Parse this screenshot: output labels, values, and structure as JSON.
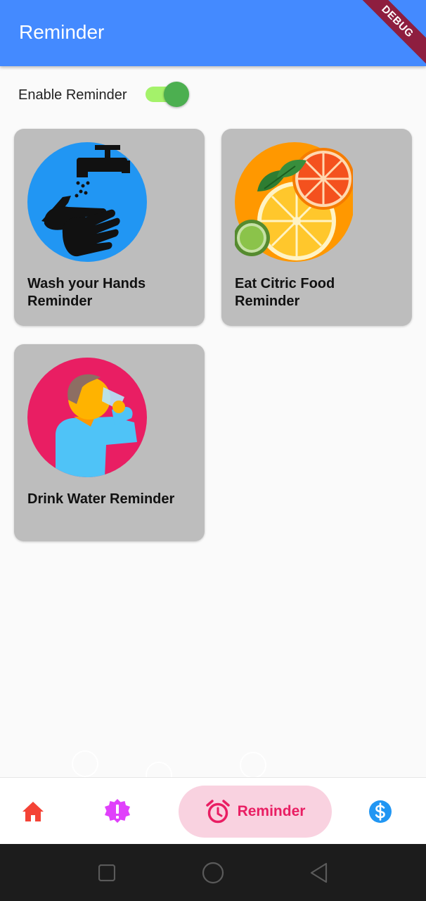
{
  "app_bar": {
    "title": "Reminder",
    "debug_banner": "DEBUG",
    "color": "#448aff"
  },
  "settings": {
    "enable_label": "Enable Reminder",
    "enabled": true
  },
  "reminders": [
    {
      "title": "Wash your Hands Reminder",
      "icon": "hand-wash-icon"
    },
    {
      "title": "Eat Citric Food Reminder",
      "icon": "citrus-fruit-icon"
    },
    {
      "title": "Drink Water Reminder",
      "icon": "drink-water-icon"
    }
  ],
  "bottom_nav": {
    "items": [
      {
        "icon": "home-icon",
        "color": "#f44336"
      },
      {
        "icon": "alert-badge-icon",
        "color": "#e040fb"
      },
      {
        "icon": "alarm-clock-icon",
        "label": "Reminder",
        "color": "#e91e63",
        "active": true
      },
      {
        "icon": "dollar-icon",
        "color": "#2196f3"
      }
    ]
  },
  "system_nav": {
    "buttons": [
      "recent-apps-icon",
      "home-circle-icon",
      "back-icon"
    ]
  }
}
